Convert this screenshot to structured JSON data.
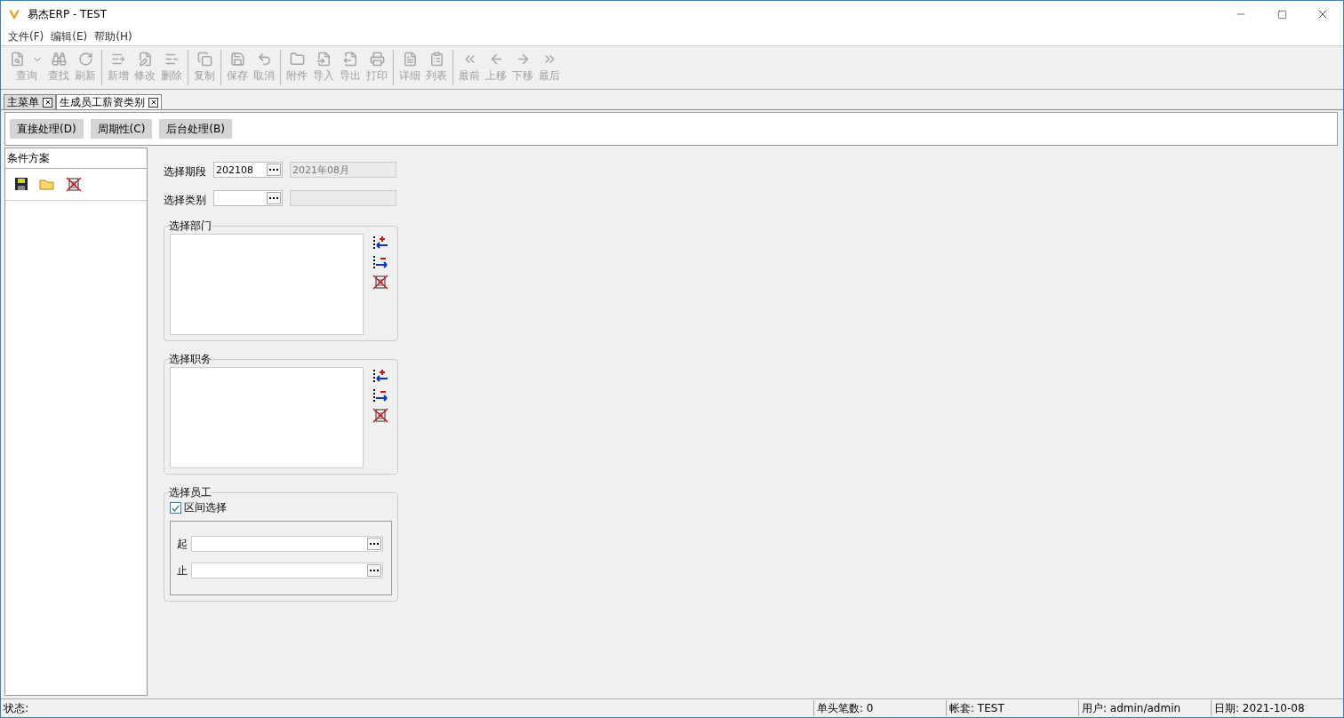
{
  "window": {
    "title": "易杰ERP - TEST"
  },
  "menu": [
    "文件(F)",
    "编辑(E)",
    "帮助(H)"
  ],
  "toolbar": {
    "groups": [
      [
        {
          "label": "查询",
          "disabled": true,
          "has_menu": true
        },
        {
          "label": "查找",
          "disabled": true,
          "has_menu": false
        },
        {
          "label": "刷新",
          "disabled": true,
          "has_menu": false
        }
      ],
      [
        {
          "label": "新增",
          "disabled": true,
          "has_menu": false
        },
        {
          "label": "修改",
          "disabled": true,
          "has_menu": false
        },
        {
          "label": "删除",
          "disabled": true,
          "has_menu": false
        }
      ],
      [
        {
          "label": "复制",
          "disabled": true,
          "has_menu": false
        }
      ],
      [
        {
          "label": "保存",
          "disabled": true,
          "has_menu": false
        },
        {
          "label": "取消",
          "disabled": true,
          "has_menu": false
        }
      ],
      [
        {
          "label": "附件",
          "disabled": true,
          "has_menu": false
        },
        {
          "label": "导入",
          "disabled": true,
          "has_menu": false
        },
        {
          "label": "导出",
          "disabled": true,
          "has_menu": false
        },
        {
          "label": "打印",
          "disabled": true,
          "has_menu": false
        }
      ],
      [
        {
          "label": "详细",
          "disabled": true,
          "has_menu": false
        },
        {
          "label": "列表",
          "disabled": true,
          "has_menu": false
        }
      ],
      [
        {
          "label": "最前",
          "disabled": true,
          "has_menu": false
        },
        {
          "label": "上移",
          "disabled": true,
          "has_menu": false
        },
        {
          "label": "下移",
          "disabled": true,
          "has_menu": false
        },
        {
          "label": "最后",
          "disabled": true,
          "has_menu": false
        }
      ]
    ]
  },
  "tabs": [
    {
      "label": "主菜单",
      "selected": false
    },
    {
      "label": "生成员工薪资类别",
      "selected": true
    }
  ],
  "process_buttons": [
    "直接处理(D)",
    "周期性(C)",
    "后台处理(B)"
  ],
  "condition_panel": {
    "title": "条件方案"
  },
  "form": {
    "period": {
      "label": "选择期段",
      "value": "202108",
      "display": "2021年08月"
    },
    "category": {
      "label": "选择类别"
    },
    "department": {
      "title": "选择部门"
    },
    "position": {
      "title": "选择职务"
    },
    "employee": {
      "title": "选择员工",
      "range": {
        "label": "区间选择",
        "checked": true
      },
      "from_label": "起",
      "to_label": "止"
    }
  },
  "status_bar": {
    "status_label": "状态:",
    "cells": [
      "单头笔数: 0",
      "帐套: TEST",
      "用户: admin/admin",
      "日期: 2021-10-08"
    ]
  }
}
